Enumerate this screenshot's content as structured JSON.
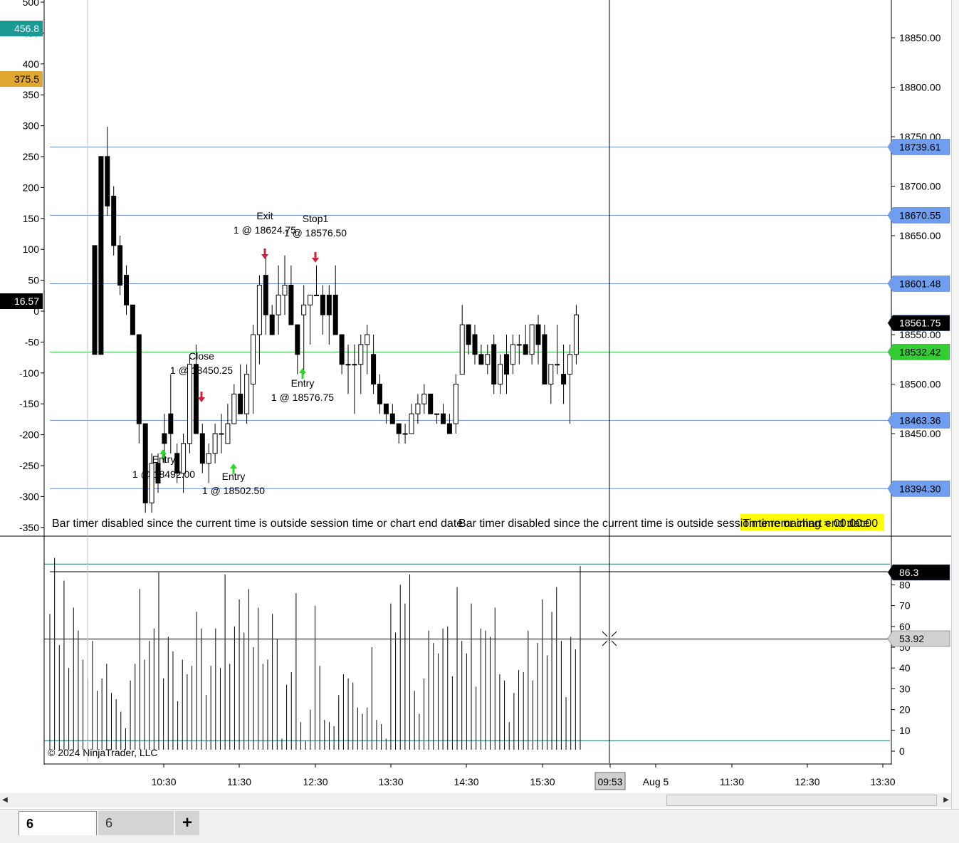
{
  "chart_data": [
    {
      "type": "candlestick",
      "instrument_panel": "price",
      "ylim": [
        18360,
        18890
      ],
      "y_ticks_right": [
        "18850.00",
        "18800.00",
        "18750.00",
        "18700.00",
        "18650.00",
        "18550.00",
        "18500.00",
        "18450.00"
      ],
      "y_ticks_left": [
        "500",
        "450",
        "400",
        "350",
        "300",
        "250",
        "200",
        "150",
        "100",
        "50",
        "0",
        "-50",
        "-100",
        "-150",
        "-200",
        "-250",
        "-300",
        "-350"
      ],
      "horizontal_lines": [
        {
          "label": "18739.61",
          "value": 18739.61,
          "color": "#6f8fe6",
          "badge": "#6f9ef0"
        },
        {
          "label": "18670.55",
          "value": 18670.55,
          "color": "#6f8fe6",
          "badge": "#6f9ef0"
        },
        {
          "label": "18601.48",
          "value": 18601.48,
          "color": "#6f8fe6",
          "badge": "#6f9ef0"
        },
        {
          "label": "18532.42",
          "value": 18532.42,
          "color": "#2ecc40",
          "badge": "#33cc33"
        },
        {
          "label": "18463.36",
          "value": 18463.36,
          "color": "#6f8fe6",
          "badge": "#6f9ef0"
        },
        {
          "label": "18394.30",
          "value": 18394.3,
          "color": "#6f8fe6",
          "badge": "#6f9ef0"
        }
      ],
      "last_price": {
        "label": "18561.75",
        "value": 18561.75
      },
      "left_badges": [
        {
          "label": "456.8",
          "color": "#1a9a94",
          "text_color": "#ffffff"
        },
        {
          "label": "375.5",
          "color": "#e0a830",
          "text_color": "#000000"
        },
        {
          "label": "16.57",
          "color": "#000000",
          "text_color": "#ffffff"
        }
      ],
      "candles": [
        [
          18640,
          18640,
          18530,
          18530
        ],
        [
          18730,
          18730,
          18530,
          18530
        ],
        [
          18730,
          18760,
          18670,
          18680
        ],
        [
          18690,
          18700,
          18630,
          18640
        ],
        [
          18640,
          18650,
          18590,
          18600
        ],
        [
          18610,
          18620,
          18570,
          18580
        ],
        [
          18580,
          18580,
          18550,
          18550
        ],
        [
          18550,
          18550,
          18440,
          18460
        ],
        [
          18460,
          18460,
          18370,
          18380
        ],
        [
          18380,
          18430,
          18370,
          18420
        ],
        [
          18420,
          18430,
          18390,
          18400
        ],
        [
          18450,
          18470,
          18420,
          18440
        ],
        [
          18470,
          18510,
          18430,
          18450
        ],
        [
          18430,
          18440,
          18400,
          18410
        ],
        [
          18410,
          18450,
          18390,
          18440
        ],
        [
          18440,
          18530,
          18430,
          18520
        ],
        [
          18520,
          18540,
          18450,
          18450
        ],
        [
          18450,
          18460,
          18410,
          18420
        ],
        [
          18420,
          18440,
          18400,
          18430
        ],
        [
          18430,
          18460,
          18420,
          18450
        ],
        [
          18450,
          18470,
          18430,
          18450
        ],
        [
          18440,
          18480,
          18440,
          18460
        ],
        [
          18460,
          18500,
          18460,
          18490
        ],
        [
          18490,
          18520,
          18470,
          18470
        ],
        [
          18470,
          18520,
          18460,
          18510
        ],
        [
          18500,
          18560,
          18470,
          18550
        ],
        [
          18550,
          18610,
          18520,
          18600
        ],
        [
          18610,
          18630,
          18550,
          18570
        ],
        [
          18570,
          18580,
          18550,
          18550
        ],
        [
          18570,
          18620,
          18550,
          18590
        ],
        [
          18590,
          18630,
          18570,
          18600
        ],
        [
          18600,
          18620,
          18560,
          18560
        ],
        [
          18560,
          18560,
          18510,
          18530
        ],
        [
          18570,
          18600,
          18510,
          18580
        ],
        [
          18580,
          18590,
          18540,
          18590
        ],
        [
          18590,
          18620,
          18590,
          18590
        ],
        [
          18590,
          18600,
          18550,
          18570
        ],
        [
          18590,
          18600,
          18540,
          18570
        ],
        [
          18590,
          18620,
          18550,
          18550
        ],
        [
          18550,
          18550,
          18510,
          18520
        ],
        [
          18520,
          18540,
          18490,
          18520
        ],
        [
          18520,
          18540,
          18470,
          18520
        ],
        [
          18520,
          18550,
          18490,
          18540
        ],
        [
          18540,
          18560,
          18510,
          18550
        ],
        [
          18530,
          18550,
          18490,
          18500
        ],
        [
          18500,
          18510,
          18470,
          18480
        ],
        [
          18480,
          18480,
          18460,
          18470
        ],
        [
          18470,
          18480,
          18460,
          18460
        ],
        [
          18460,
          18460,
          18440,
          18450
        ],
        [
          18450,
          18460,
          18440,
          18450
        ],
        [
          18450,
          18480,
          18450,
          18470
        ],
        [
          18470,
          18490,
          18460,
          18480
        ],
        [
          18480,
          18500,
          18470,
          18490
        ],
        [
          18490,
          18490,
          18470,
          18470
        ],
        [
          18470,
          18470,
          18460,
          18470
        ],
        [
          18470,
          18480,
          18460,
          18460
        ],
        [
          18460,
          18470,
          18450,
          18450
        ],
        [
          18460,
          18510,
          18450,
          18500
        ],
        [
          18510,
          18580,
          18510,
          18560
        ],
        [
          18560,
          18560,
          18530,
          18540
        ],
        [
          18550,
          18560,
          18520,
          18530
        ],
        [
          18530,
          18540,
          18520,
          18520
        ],
        [
          18520,
          18540,
          18510,
          18530
        ],
        [
          18540,
          18550,
          18490,
          18500
        ],
        [
          18500,
          18530,
          18490,
          18520
        ],
        [
          18530,
          18550,
          18490,
          18510
        ],
        [
          18520,
          18550,
          18510,
          18540
        ],
        [
          18540,
          18550,
          18520,
          18540
        ],
        [
          18540,
          18560,
          18530,
          18530
        ],
        [
          18530,
          18560,
          18520,
          18560
        ],
        [
          18560,
          18570,
          18520,
          18540
        ],
        [
          18550,
          18560,
          18500,
          18500
        ],
        [
          18500,
          18520,
          18480,
          18520
        ],
        [
          18520,
          18560,
          18510,
          18520
        ],
        [
          18510,
          18540,
          18480,
          18500
        ],
        [
          18510,
          18540,
          18460,
          18530
        ],
        [
          18530,
          18580,
          18520,
          18570
        ]
      ],
      "markers": [
        {
          "kind": "entry",
          "label": "Entry",
          "price_label": "1 @ 18492.00"
        },
        {
          "kind": "close",
          "label": "Close",
          "price_label": "1 @ 18450.25"
        },
        {
          "kind": "entry",
          "label": "Entry",
          "price_label": "1 @ 18502.50"
        },
        {
          "kind": "exit",
          "label": "Exit",
          "price_label": "1 @ 18624.75"
        },
        {
          "kind": "stop",
          "label": "Stop1",
          "price_label": "1 @ 18576.50"
        },
        {
          "kind": "entry",
          "label": "Entry",
          "price_label": "1 @ 18576.75"
        }
      ],
      "notes": [
        "Bar timer disabled since the current time is outside session time or chart end date",
        "Bar timer disabled since the current time is outside session time or chart end date"
      ],
      "yellow_label": "Time remaining = 00:00:00"
    },
    {
      "type": "bar",
      "instrument_panel": "indicator",
      "ylim": [
        -2,
        92
      ],
      "y_ticks": [
        "80",
        "70",
        "60",
        "50",
        "40",
        "30",
        "20",
        "10",
        "0"
      ],
      "levels": [
        {
          "value": 90,
          "color": "#1a7a7a"
        },
        {
          "value": 5,
          "color": "#1a7a7a"
        }
      ],
      "current": {
        "label": "86.3",
        "value": 86.3
      },
      "crosshair": {
        "label": "53.92",
        "value": 53.92
      },
      "values": [
        66,
        93,
        51,
        82,
        40,
        69,
        58,
        44,
        35,
        53,
        29,
        35,
        42,
        28,
        25,
        19,
        11,
        34,
        42,
        78,
        44,
        53,
        59,
        86,
        35,
        55,
        48,
        24,
        44,
        37,
        41,
        67,
        59,
        27,
        41,
        59,
        40,
        85,
        42,
        60,
        73,
        57,
        78,
        50,
        69,
        42,
        44,
        66,
        54,
        6,
        32,
        38,
        76,
        14,
        5,
        20,
        70,
        41,
        15,
        14,
        12,
        27,
        37,
        35,
        33,
        21,
        18,
        21,
        50,
        15,
        13,
        6,
        71,
        57,
        80,
        71,
        85,
        29,
        18,
        35,
        58,
        52,
        47,
        59,
        60,
        36,
        79,
        53,
        47,
        71,
        31,
        59,
        58,
        55,
        69,
        37,
        34,
        14,
        28,
        39,
        38,
        58,
        34,
        52,
        73,
        46,
        67,
        79,
        53,
        26,
        55,
        49,
        89
      ],
      "x_ticks": [
        "10:30",
        "11:30",
        "12:30",
        "13:30",
        "14:30",
        "15:30",
        "09:53",
        "Aug 5",
        "11:30",
        "12:30",
        "13:30"
      ],
      "copyright": "© 2024 NinjaTrader, LLC"
    }
  ],
  "tabs": [
    {
      "label": "6"
    },
    {
      "label": "6"
    },
    {
      "label": "+"
    }
  ]
}
